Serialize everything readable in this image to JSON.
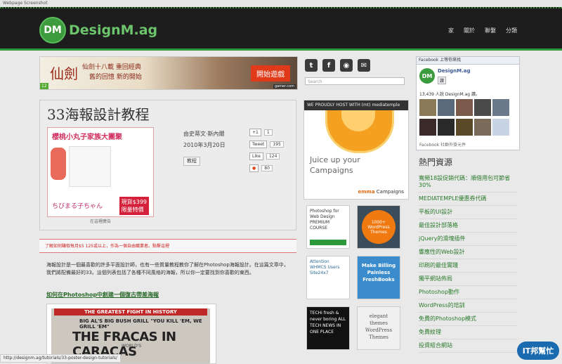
{
  "window_title": "Webpage Screenshot",
  "header": {
    "logo_mark": "DM",
    "logo_text": "DesignM.ag",
    "nav": [
      "家",
      "關於",
      "聯繫",
      "分類"
    ]
  },
  "banner_ad": {
    "title": "仙劍",
    "line1": "仙劍十八載 重回經典",
    "line2": "舊的回憶 新的開始",
    "button": "開始遊戲",
    "rating": "12",
    "site": "gamer.com"
  },
  "article": {
    "title": "33海報設計教程",
    "author": "由史蒂文·斯內爾",
    "date": "2010年3月20日",
    "tag": "教程",
    "ad_headline": "櫻桃小丸子家族大團聚",
    "ad_brand": "ちびまる子ちゃん",
    "ad_price": "現貨$399",
    "ad_price_note": "限量特價",
    "ad_label": "在這裡廣告",
    "social": {
      "gplus_label": "+1",
      "gplus_count": "1",
      "tweet_label": "Tweet",
      "tweet_count": "195",
      "like_label": "Like",
      "like_count": "124",
      "su_count": "80"
    }
  },
  "notice": "了解如何賺取每月$5 125或以上，作為一個自由職業者。點擊這裡",
  "body_text": "海報設計是一個最喜歡的許多平面設計師，也有一些質量教程教你了解在Photoshop海報設計。在這篇文章中，我們將配備最好的33。這個列表包括了各種不同風格的海報，所以你一定要找到你喜歡的東西。",
  "subhead": "如何在Photoshop中創建一個復古帶差海報",
  "post_image": {
    "banner": "THE GREATEST FIGHT IN HISTORY",
    "line2": "BIG AL'S BIG BUSH GRILL  \"YOU KILL 'EM, WE GRILL 'EM\"",
    "line3": "THE FRACAS IN CARACAS",
    "line4": "WORLD'S"
  },
  "sidebar": {
    "search_placeholder": "Search",
    "mt_bar": "WE PROUDLY HOST WITH (mt) mediatemple",
    "mt_line1": "Juice up your",
    "mt_line2": "Campaigns",
    "mt_brand": "Campaigns",
    "ads": [
      "Photoshop for Web Design PREMIUM COURSE",
      "1000+ WordPress Themes",
      "Attention WHMCS Users Site24x7",
      "Make Billing Painless FreshBooks",
      "TECHi fresh & never boring ALL TECH NEWS IN ONE PLACE",
      "elegant themes WordPress Themes"
    ]
  },
  "facebook": {
    "header": "Facebook 上等你來找",
    "page_name": "DesignM.ag",
    "like": "讚",
    "count": "13,439 人說 DesignM.ag 讚。",
    "footer": "Facebook 社群外掛元件"
  },
  "resources": {
    "title": "熱門資源",
    "links": [
      "寬頻18設促銷代碼：順借用包可節省30%",
      "MEDIATEMPLE優惠券代碼",
      "平板的UI設計",
      "最佳設計部落格",
      "jQuery的滑塊插件",
      "響應性的Web設計",
      "印刷的最佳實踐",
      "獨平網站佈局",
      "Photoshop動作",
      "WordPress的培訓",
      "免費的Photoshop模式",
      "免費紋理",
      "投資組合網站"
    ]
  },
  "status_url": "http://designm.ag/tutorials/33-poster-design-tutorials/",
  "watermark": "IT邦幫忙"
}
